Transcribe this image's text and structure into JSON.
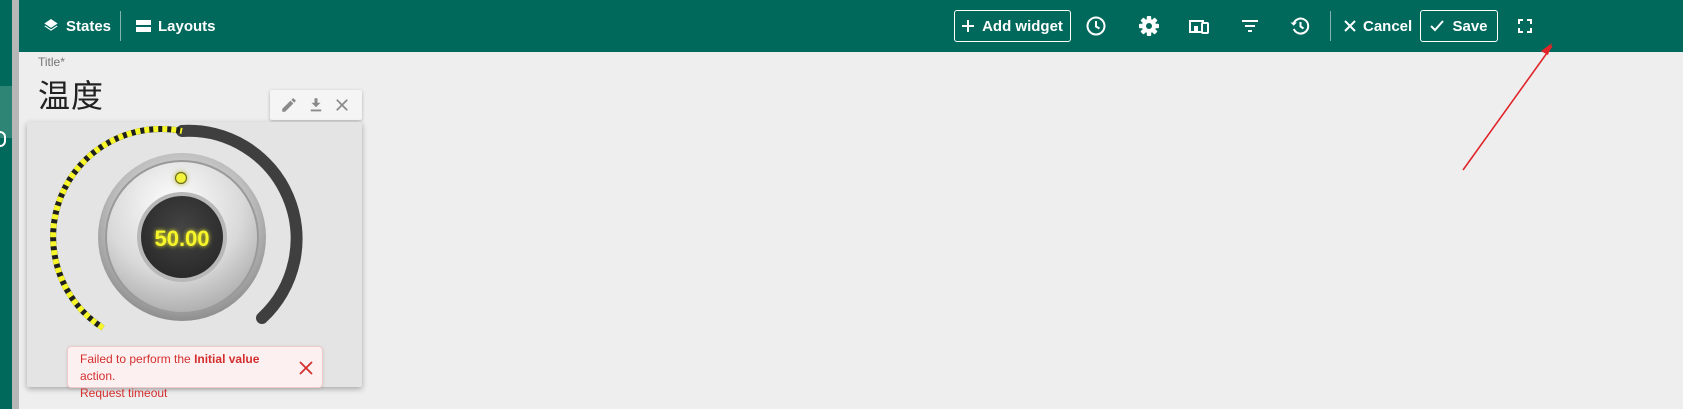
{
  "toolbar": {
    "states_label": "States",
    "layouts_label": "Layouts",
    "add_widget_label": "Add widget",
    "cancel_label": "Cancel",
    "save_label": "Save"
  },
  "dashboard": {
    "title_label": "Title*",
    "title_value": "温度"
  },
  "widget": {
    "knob_value": "50.00",
    "value_fraction": 0.5
  },
  "toast": {
    "message_prefix": "Failed to perform the ",
    "message_bold": "Initial value",
    "message_suffix": " action.",
    "message_line2": "Request timeout"
  },
  "colors": {
    "header": "#00695c",
    "accent_yellow": "#f6f62a",
    "error_red": "#d32f2f"
  }
}
